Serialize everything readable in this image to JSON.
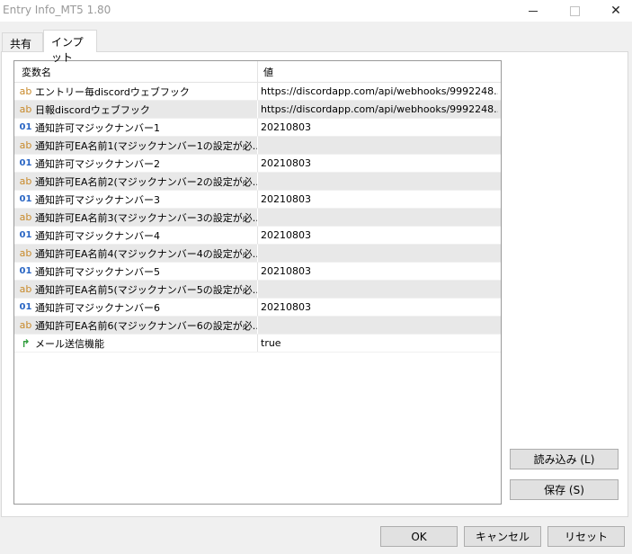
{
  "window": {
    "title": "Entry Info_MT5 1.80",
    "close_symbol": "✕"
  },
  "tabs": [
    {
      "label": "共有"
    },
    {
      "label": "インプット"
    }
  ],
  "grid": {
    "columns": {
      "name": "変数名",
      "value": "値"
    },
    "rows": [
      {
        "type": "ab",
        "name": "エントリー毎discordウェブフック",
        "value": "https://discordapp.com/api/webhooks/9992248..."
      },
      {
        "type": "ab",
        "name": "日報discordウェブフック",
        "value": "https://discordapp.com/api/webhooks/9992248..."
      },
      {
        "type": "01",
        "name": "通知許可マジックナンバー1",
        "value": "20210803"
      },
      {
        "type": "ab",
        "name": "通知許可EA名前1(マジックナンバー1の設定が必...",
        "value": ""
      },
      {
        "type": "01",
        "name": "通知許可マジックナンバー2",
        "value": "20210803"
      },
      {
        "type": "ab",
        "name": "通知許可EA名前2(マジックナンバー2の設定が必...",
        "value": ""
      },
      {
        "type": "01",
        "name": "通知許可マジックナンバー3",
        "value": "20210803"
      },
      {
        "type": "ab",
        "name": "通知許可EA名前3(マジックナンバー3の設定が必...",
        "value": ""
      },
      {
        "type": "01",
        "name": "通知許可マジックナンバー4",
        "value": "20210803"
      },
      {
        "type": "ab",
        "name": "通知許可EA名前4(マジックナンバー4の設定が必...",
        "value": ""
      },
      {
        "type": "01",
        "name": "通知許可マジックナンバー5",
        "value": "20210803"
      },
      {
        "type": "ab",
        "name": "通知許可EA名前5(マジックナンバー5の設定が必...",
        "value": ""
      },
      {
        "type": "01",
        "name": "通知許可マジックナンバー6",
        "value": "20210803"
      },
      {
        "type": "ab",
        "name": "通知許可EA名前6(マジックナンバー6の設定が必...",
        "value": ""
      },
      {
        "type": "bool",
        "name": "メール送信機能",
        "value": "true"
      }
    ]
  },
  "buttons": {
    "load": "読み込み (L)",
    "save": "保存 (S)",
    "ok": "OK",
    "cancel": "キャンセル",
    "reset": "リセット"
  },
  "icons": {
    "string_type": "ab",
    "int_type": "01",
    "bool_type": "↱"
  }
}
